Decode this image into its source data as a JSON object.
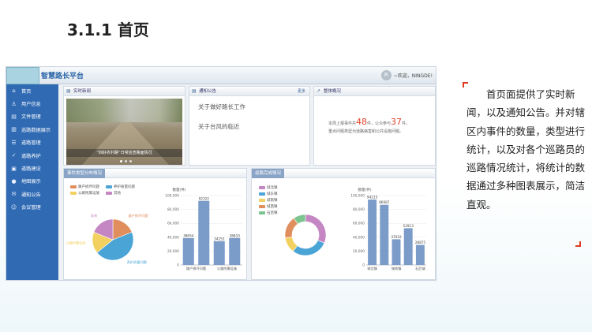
{
  "slide": {
    "title": "3.1.1 首页",
    "description": "首页面提供了实时新闻，以及通知公告。并对辖区内事件的数量，类型进行统计，以及对各个巡路员的巡路情况统计，将统计的数据通过多种图表展示，简洁直观。",
    "accent_color": "#e03a1e"
  },
  "app": {
    "title": "智慧路长平台",
    "user_avatar": "R",
    "user_greeting": "~欢迎，NINGDE!",
    "sidebar": {
      "items": [
        {
          "icon": "home-icon",
          "label": "首页"
        },
        {
          "icon": "user-icon",
          "label": "用户信息"
        },
        {
          "icon": "document-icon",
          "label": "文件管理"
        },
        {
          "icon": "bar-chart-icon",
          "label": "巡路数据展示"
        },
        {
          "icon": "list-icon",
          "label": "道路管理"
        },
        {
          "icon": "check-circle-icon",
          "label": "道路养护"
        },
        {
          "icon": "image-icon",
          "label": "道路建设"
        },
        {
          "icon": "map-pin-icon",
          "label": "地图展示"
        },
        {
          "icon": "mail-icon",
          "label": "通知公告"
        },
        {
          "icon": "chat-icon",
          "label": "会议管理"
        }
      ],
      "color": "#2f6ab3"
    },
    "news": {
      "header": "实时新闻",
      "caption": "“四好农村路”日常巡查路面情况",
      "dots": 3
    },
    "notice": {
      "header": "通知公告",
      "more": "更多",
      "items": [
        "关于做好路长工作",
        "关于台风的临近"
      ]
    },
    "stats": {
      "header": "整体概况",
      "line1_prefix": "本周上报事件共",
      "events": "48",
      "line1_mid": "件，公众参与",
      "public": "37",
      "line1_suffix": "件。",
      "line2": "重点问题类型为道路病害和公共设施问题。"
    },
    "event_panel": {
      "header": "事件类型分布情况"
    },
    "patrol_panel": {
      "header": "巡路完成情况"
    }
  },
  "chart_data": [
    {
      "type": "pie",
      "title": "",
      "labels": [
        "路产损坏问题",
        "养护质量问题",
        "公路附属设施",
        "其他"
      ],
      "values": [
        38654,
        92322,
        34253,
        38810
      ],
      "colors": [
        "#e08e5d",
        "#4aa5d6",
        "#f2d160",
        "#c586c4"
      ],
      "slice_labels": [
        "路产损坏问题",
        "养护质量问题",
        "公路附属设施",
        "其他"
      ]
    },
    {
      "type": "bar",
      "title": "",
      "ylabel": "数量(件)",
      "categories": [
        "路产损坏问题",
        "公路附属设施"
      ],
      "bar_labels": [
        "38654",
        "92322",
        "34253",
        "38810"
      ],
      "values": [
        38654,
        92322,
        34253,
        38810
      ],
      "yticks": [
        "100,000",
        "80,000",
        "60,000",
        "40,000",
        "20,000",
        "0"
      ],
      "ylim": [
        0,
        100000
      ],
      "color": "#7b9bc9"
    },
    {
      "type": "pie",
      "title": "",
      "labels": [
        "城北镇",
        "城东镇",
        "城南镇",
        "城西镇",
        "石后镇"
      ],
      "values": [
        94215,
        86687,
        37022,
        52913,
        28875
      ],
      "colors": [
        "#c586c4",
        "#4aa5d6",
        "#f2d160",
        "#e08e5d",
        "#7cc58f"
      ],
      "donut": true
    },
    {
      "type": "bar",
      "title": "",
      "ylabel": "数量(件)",
      "categories": [
        "城北镇",
        "城南镇",
        "石后镇"
      ],
      "bar_labels": [
        "94215",
        "86687",
        "37022",
        "52913",
        "28875"
      ],
      "values": [
        94215,
        86687,
        37022,
        52913,
        28875
      ],
      "yticks": [
        "100,000",
        "80,000",
        "60,000",
        "40,000",
        "20,000",
        "0"
      ],
      "ylim": [
        0,
        100000
      ],
      "color": "#7b9bc9"
    }
  ]
}
